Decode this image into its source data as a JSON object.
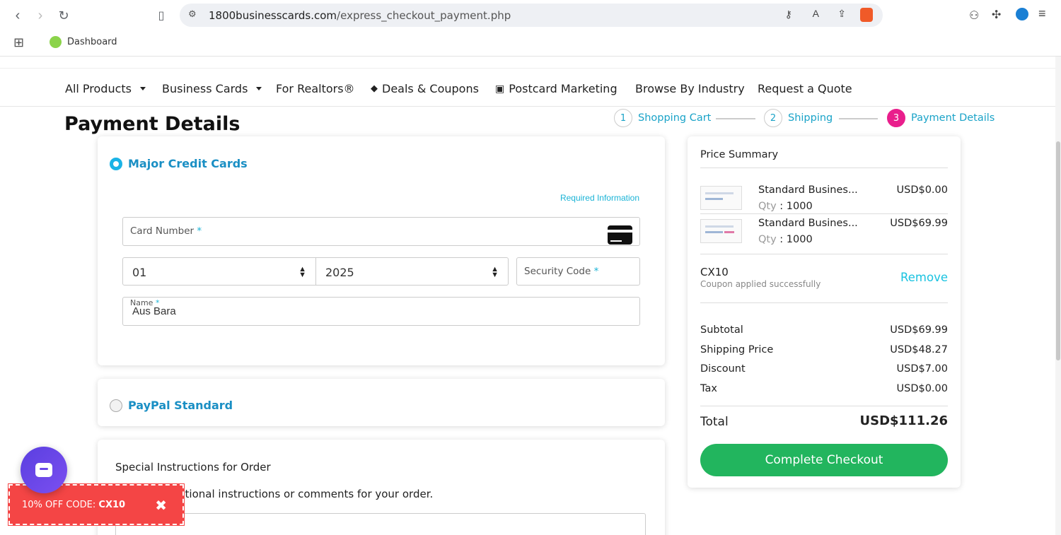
{
  "browser": {
    "url_host": "1800businesscards.com",
    "url_path": "/express_checkout_payment.php",
    "bookmark": "Dashboard"
  },
  "nav": {
    "items": [
      "All Products",
      "Business Cards",
      "For Realtors®",
      "Deals & Coupons",
      "Postcard Marketing",
      "Browse By Industry",
      "Request a Quote"
    ]
  },
  "page": {
    "title": "Payment Details"
  },
  "steps": [
    {
      "num": "1",
      "label": "Shopping Cart"
    },
    {
      "num": "2",
      "label": "Shipping"
    },
    {
      "num": "3",
      "label": "Payment Details"
    }
  ],
  "payment": {
    "credit_label": "Major Credit Cards",
    "required_info": "Required Information",
    "card_number_label": "Card Number",
    "required_mark": "*",
    "month_value": "01",
    "year_value": "2025",
    "security_label": "Security Code",
    "name_label": "Name",
    "name_value": "Aus Bara",
    "paypal_label": "PayPal Standard"
  },
  "special": {
    "title": "Special Instructions for Order",
    "help": "Add any additional instructions or comments for your order."
  },
  "summary": {
    "title": "Price Summary",
    "items": [
      {
        "name": "Standard Busines...",
        "qty_label": "Qty",
        "qty": ": 1000",
        "price": "USD$0.00"
      },
      {
        "name": "Standard Busines...",
        "qty_label": "Qty",
        "qty": ": 1000",
        "price": "USD$69.99"
      }
    ],
    "coupon_code": "CX10",
    "coupon_msg": "Coupon applied successfully",
    "remove_label": "Remove",
    "rows": [
      {
        "label": "Subtotal",
        "value": "USD$69.99"
      },
      {
        "label": "Shipping Price",
        "value": "USD$48.27"
      },
      {
        "label": "Discount",
        "value": "USD$7.00"
      },
      {
        "label": "Tax",
        "value": "USD$0.00"
      }
    ],
    "total_label": "Total",
    "total_value": "USD$111.26",
    "checkout_label": "Complete Checkout"
  },
  "promo": {
    "prefix": "10% OFF CODE: ",
    "code": "CX10",
    "close": "✖"
  },
  "colors": {
    "accent": "#1ab3e6",
    "step_active": "#e91e8c",
    "checkout": "#22b55e",
    "promo": "#f44545"
  }
}
